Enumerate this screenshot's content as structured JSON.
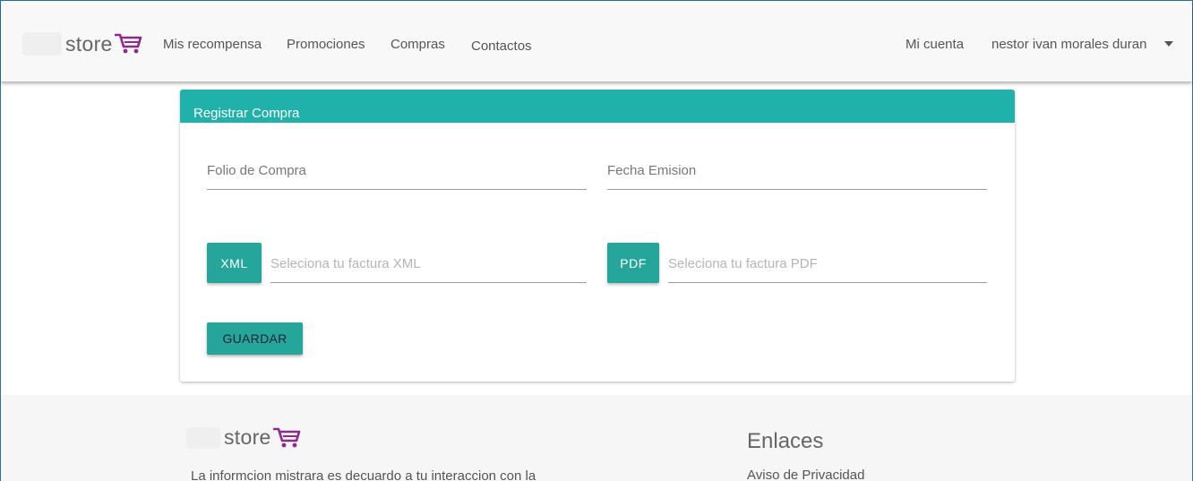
{
  "navbar": {
    "brand": "store",
    "links": [
      "Mis recompensa",
      "Promociones",
      "Compras",
      "Contactos"
    ],
    "account_label": "Mi cuenta",
    "user_name": "nestor ivan morales duran"
  },
  "form": {
    "title": "Registrar Compra",
    "folio_label": "Folio de Compra",
    "fecha_label": "Fecha Emision",
    "xml_button": "XML",
    "xml_placeholder": "Seleciona tu factura XML",
    "pdf_button": "PDF",
    "pdf_placeholder": "Seleciona tu factura PDF",
    "save_button": "GUARDAR"
  },
  "footer": {
    "brand": "store",
    "description": "La informcion mistrara es decuardo a tu interaccion con la",
    "links_title": "Enlaces",
    "links": [
      "Aviso de Privacidad"
    ]
  },
  "colors": {
    "header_teal": "#20b2aa",
    "button_teal": "#26a69a",
    "cart_purple": "#8e2a8e"
  }
}
